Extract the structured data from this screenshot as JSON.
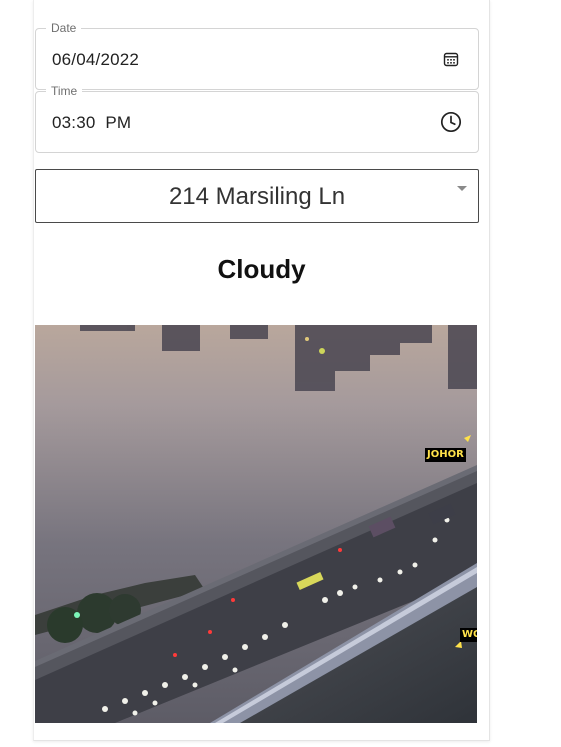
{
  "date_field": {
    "label": "Date",
    "value": "06/04/2022",
    "icon": "calendar-icon"
  },
  "time_field": {
    "label": "Time",
    "value": "03:30  PM",
    "icon": "clock-icon"
  },
  "location_select": {
    "value": "214 Marsiling Ln",
    "icon": "chevron-down-icon"
  },
  "weather": {
    "forecast": "Cloudy"
  },
  "camera": {
    "labels": [
      "JOHOR",
      "WO"
    ],
    "label_color": "#ffe24a"
  }
}
